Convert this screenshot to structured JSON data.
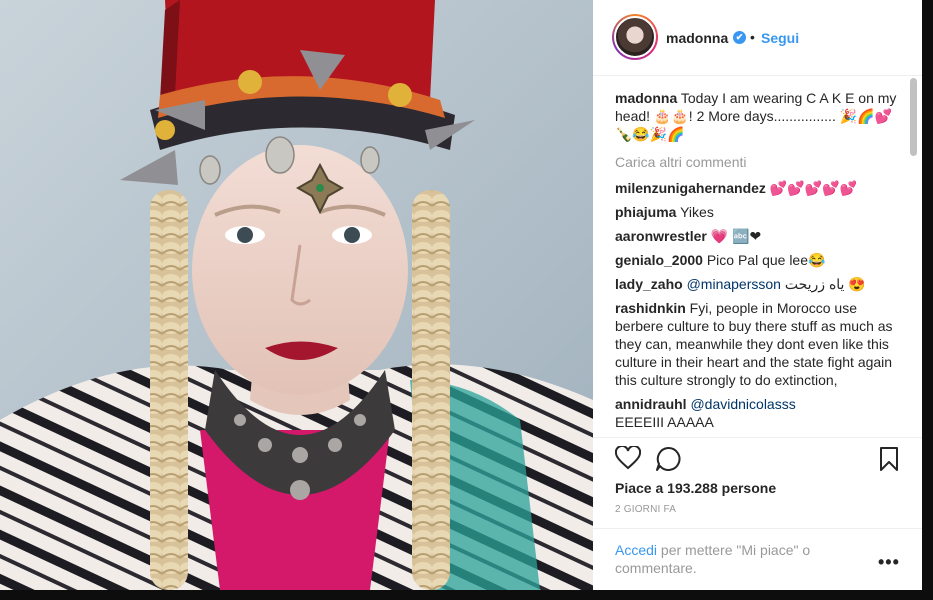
{
  "post": {
    "username": "madonna",
    "verified_mark": "✔",
    "separator": "•",
    "follow_label": "Segui",
    "caption_user": "madonna",
    "caption_text": " Today I am wearing C A K E on my head! 🎂🎂! 2 More days................ 🎉🌈💕🍾😂🎉🌈",
    "load_more": "Carica altri commenti",
    "likes": "Piace a 193.288 persone",
    "date": "2 GIORNI FA",
    "login_link": "Accedi",
    "login_text": " per mettere \"Mi piace\" o commentare.",
    "more_options": "•••"
  },
  "comments": [
    {
      "user": "milenzunigahernandez",
      "text": " 💕💕💕💕💕"
    },
    {
      "user": "phiajuma",
      "text": " Yikes"
    },
    {
      "user": "aaronwrestler",
      "text": " 💗 🔤❤"
    },
    {
      "user": "genialo_2000",
      "text": " Pico Pal que lee😂"
    },
    {
      "user": "lady_zaho",
      "mention": " @minapersson",
      "text": " ياه زريحت 😍"
    },
    {
      "user": "rashidnkin",
      "text": " Fyi, people in Morocco use berbere culture to buy there stuff as much as they can, meanwhile they dont even like this culture in their heart and the state fight again this culture strongly to do extinction,"
    },
    {
      "user": "annidrauhl",
      "mention": " @davidnicolasss",
      "text": " EEEEIII AAAAA"
    }
  ],
  "icons": {
    "like": "heart-outline-icon",
    "comment": "speech-bubble-icon",
    "save": "bookmark-icon",
    "options": "ellipsis-icon"
  },
  "colors": {
    "link_blue": "#3897f0",
    "text_dark": "#262626",
    "text_muted": "#999999",
    "background_dark": "#0d0d0d"
  }
}
